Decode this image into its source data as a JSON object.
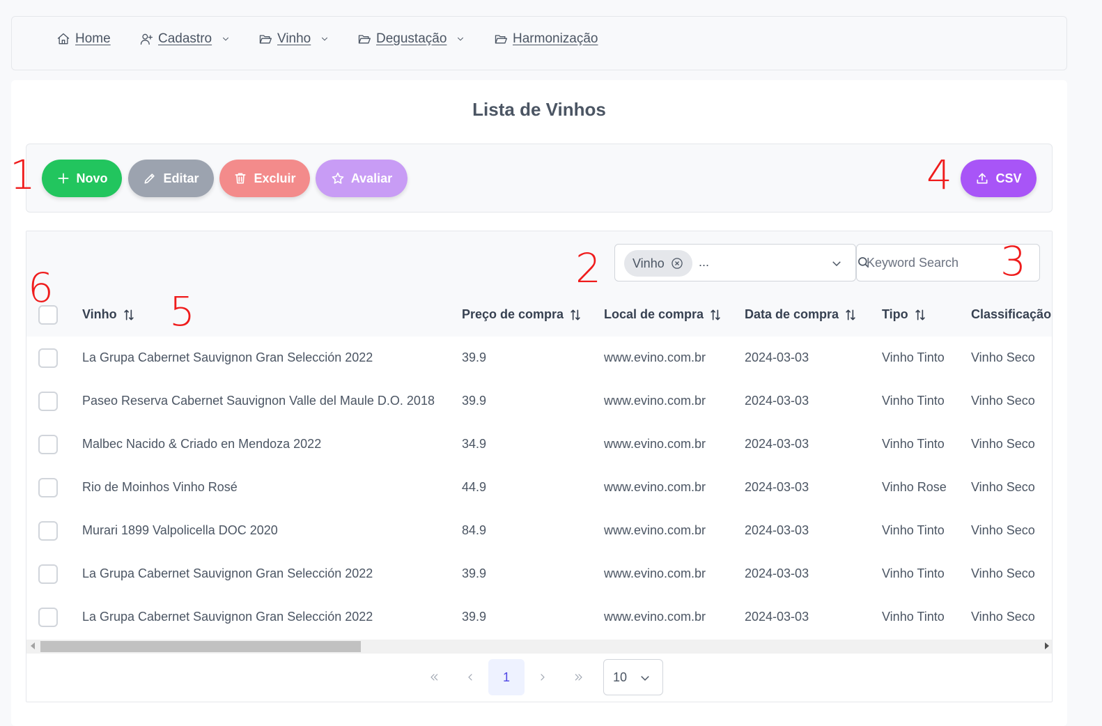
{
  "nav": {
    "home": "Home",
    "cadastro": "Cadastro",
    "vinho": "Vinho",
    "degustacao": "Degustação",
    "harmonizacao": "Harmonização"
  },
  "page": {
    "title": "Lista de Vinhos"
  },
  "toolbar": {
    "novo": "Novo",
    "editar": "Editar",
    "excluir": "Excluir",
    "avaliar": "Avaliar",
    "csv": "CSV"
  },
  "colors": {
    "novo": "#22c55e",
    "editar": "#9ca3af",
    "excluir": "#f38b8b",
    "avaliar": "#c89cf5",
    "csv": "#a855f7",
    "annotation": "#ef1c1c"
  },
  "filter": {
    "chip": "Vinho",
    "more": "...",
    "search_placeholder": "Keyword Search"
  },
  "table": {
    "columns": [
      "Vinho",
      "Preço de compra",
      "Local de compra",
      "Data de compra",
      "Tipo",
      "Classificação"
    ],
    "rows": [
      [
        "La Grupa Cabernet Sauvignon Gran Selección 2022",
        "39.9",
        "www.evino.com.br",
        "2024-03-03",
        "Vinho Tinto",
        "Vinho Seco"
      ],
      [
        "Paseo Reserva Cabernet Sauvignon Valle del Maule D.O. 2018",
        "39.9",
        "www.evino.com.br",
        "2024-03-03",
        "Vinho Tinto",
        "Vinho Seco"
      ],
      [
        "Malbec Nacido & Criado en Mendoza 2022",
        "34.9",
        "www.evino.com.br",
        "2024-03-03",
        "Vinho Tinto",
        "Vinho Seco"
      ],
      [
        "Rio de Moinhos Vinho Rosé",
        "44.9",
        "www.evino.com.br",
        "2024-03-03",
        "Vinho Rose",
        "Vinho Seco"
      ],
      [
        "Murari 1899 Valpolicella DOC 2020",
        "84.9",
        "www.evino.com.br",
        "2024-03-03",
        "Vinho Tinto",
        "Vinho Seco"
      ],
      [
        "La Grupa Cabernet Sauvignon Gran Selección 2022",
        "39.9",
        "www.evino.com.br",
        "2024-03-03",
        "Vinho Tinto",
        "Vinho Seco"
      ],
      [
        "La Grupa Cabernet Sauvignon Gran Selección 2022",
        "39.9",
        "www.evino.com.br",
        "2024-03-03",
        "Vinho Tinto",
        "Vinho Seco"
      ]
    ]
  },
  "pagination": {
    "current_page": "1",
    "rows_per_page": "10"
  },
  "annotations": [
    "1",
    "2",
    "3",
    "4",
    "5",
    "6"
  ]
}
